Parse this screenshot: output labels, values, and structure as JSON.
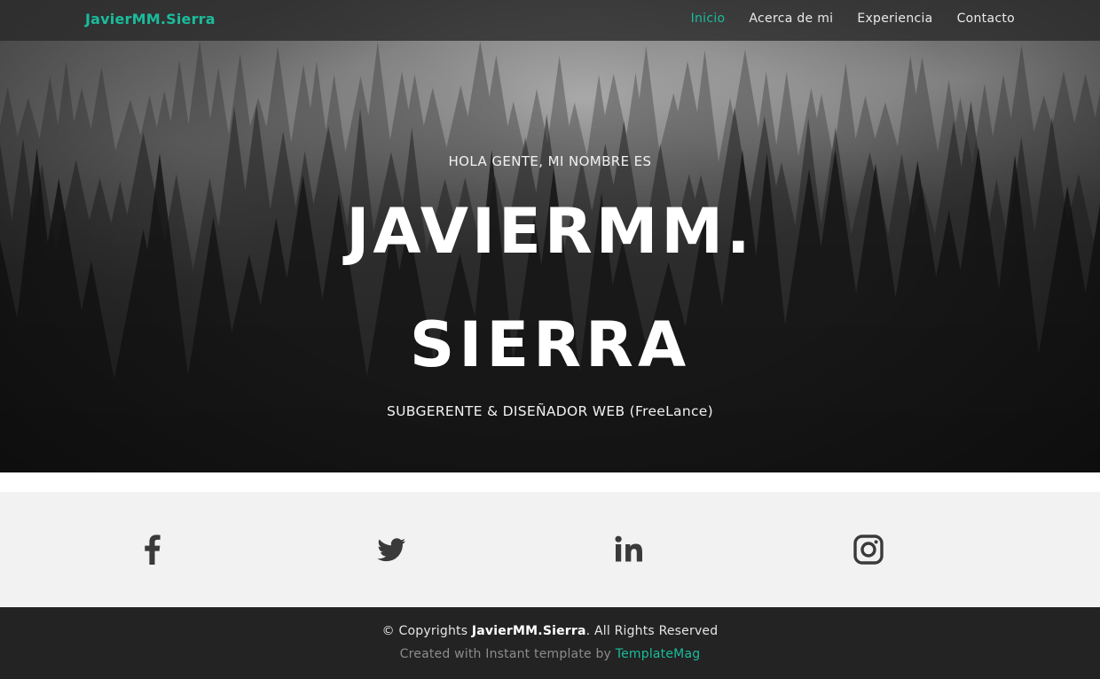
{
  "navbar": {
    "brand": "JavierMM.Sierra",
    "items": [
      {
        "label": "Inicio",
        "active": true
      },
      {
        "label": "Acerca de mi",
        "active": false
      },
      {
        "label": "Experiencia",
        "active": false
      },
      {
        "label": "Contacto",
        "active": false
      }
    ]
  },
  "hero": {
    "greeting": "HOLA GENTE, MI NOMBRE ES",
    "name_line1": "JAVIERMM.",
    "name_line2": "SIERRA",
    "subtitle": "SUBGERENTE & DISEÑADOR WEB (FreeLance)"
  },
  "social": {
    "icons": [
      "facebook-icon",
      "twitter-icon",
      "linkedin-icon",
      "instagram-icon"
    ]
  },
  "footer": {
    "copy_prefix": "© Copyrights ",
    "copy_brand": "JavierMM.Sierra",
    "copy_suffix": ". All Rights Reserved",
    "credit_text": "Created with Instant template by ",
    "credit_link": "TemplateMag"
  },
  "colors": {
    "accent": "#1abc9c",
    "footer_bg": "#232323",
    "social_bg": "#f2f2f2",
    "icon": "#3a3a3a"
  }
}
